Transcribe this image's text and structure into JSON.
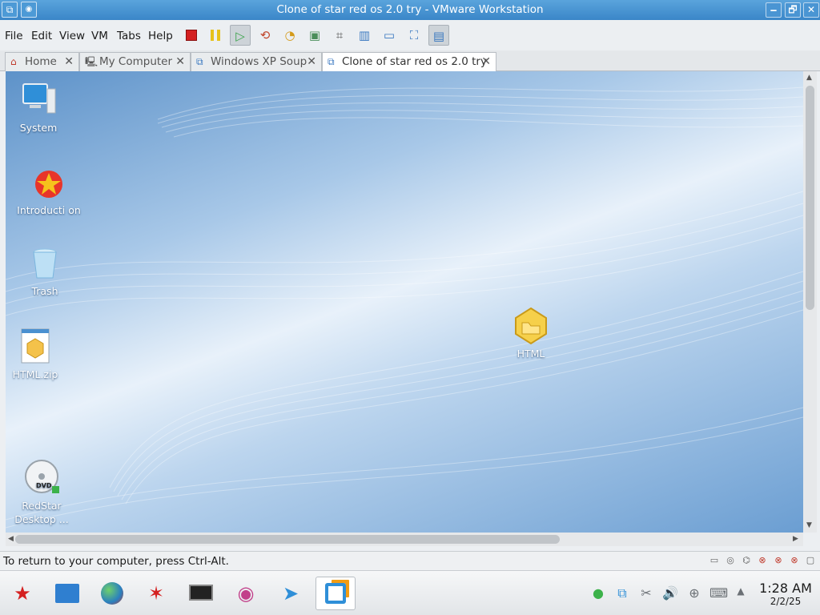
{
  "window": {
    "title": "Clone of star red os 2.0 try - VMware Workstation",
    "minimize_glyph": "🗕",
    "maximize_glyph": "🗗",
    "close_glyph": "✕"
  },
  "menu": {
    "items": [
      "File",
      "Edit",
      "View",
      "VM",
      "Tabs",
      "Help"
    ]
  },
  "toolbar": {
    "icons": [
      "power-off-icon",
      "pause-icon",
      "play-icon",
      "revert-snapshot-icon",
      "take-snapshot-icon",
      "snapshot-manager-icon",
      "capture-icon",
      "sidebar-icon",
      "console-icon",
      "fullscreen-icon",
      "unity-icon"
    ]
  },
  "tabs": [
    {
      "label": "Home",
      "icon": "home-icon",
      "active": false
    },
    {
      "label": "My Computer",
      "icon": "computer-icon",
      "active": false
    },
    {
      "label": "Windows XP Soup",
      "icon": "vm-icon",
      "active": false
    },
    {
      "label": "Clone of star red os 2.0 try",
      "icon": "vm-icon",
      "active": true
    }
  ],
  "desktop": {
    "icons": [
      {
        "label": "System",
        "icon": "monitor-icon"
      },
      {
        "label": "Introducti on",
        "icon": "redstar-icon"
      },
      {
        "label": "Trash",
        "icon": "trash-icon"
      },
      {
        "label": "HTML.zip",
        "icon": "zip-icon"
      },
      {
        "label": "RedStar Desktop ...",
        "icon": "dvd-icon"
      },
      {
        "label": "HTML",
        "icon": "folder-icon"
      }
    ]
  },
  "statusbar": {
    "message": "To return to your computer, press Ctrl-Alt."
  },
  "taskbar": {
    "apps": [
      "redstar-menu-icon",
      "file-manager-icon",
      "browser-icon",
      "redstar-app-icon",
      "terminal-icon",
      "media-icon",
      "app-icon",
      "vmware-icon"
    ],
    "clock": {
      "time": "1:28 AM",
      "date": "2/2/25"
    }
  },
  "colors": {
    "titlebar": "#3a86c8",
    "accent": "#4d9ad6",
    "desktop": "#8fb6df"
  }
}
